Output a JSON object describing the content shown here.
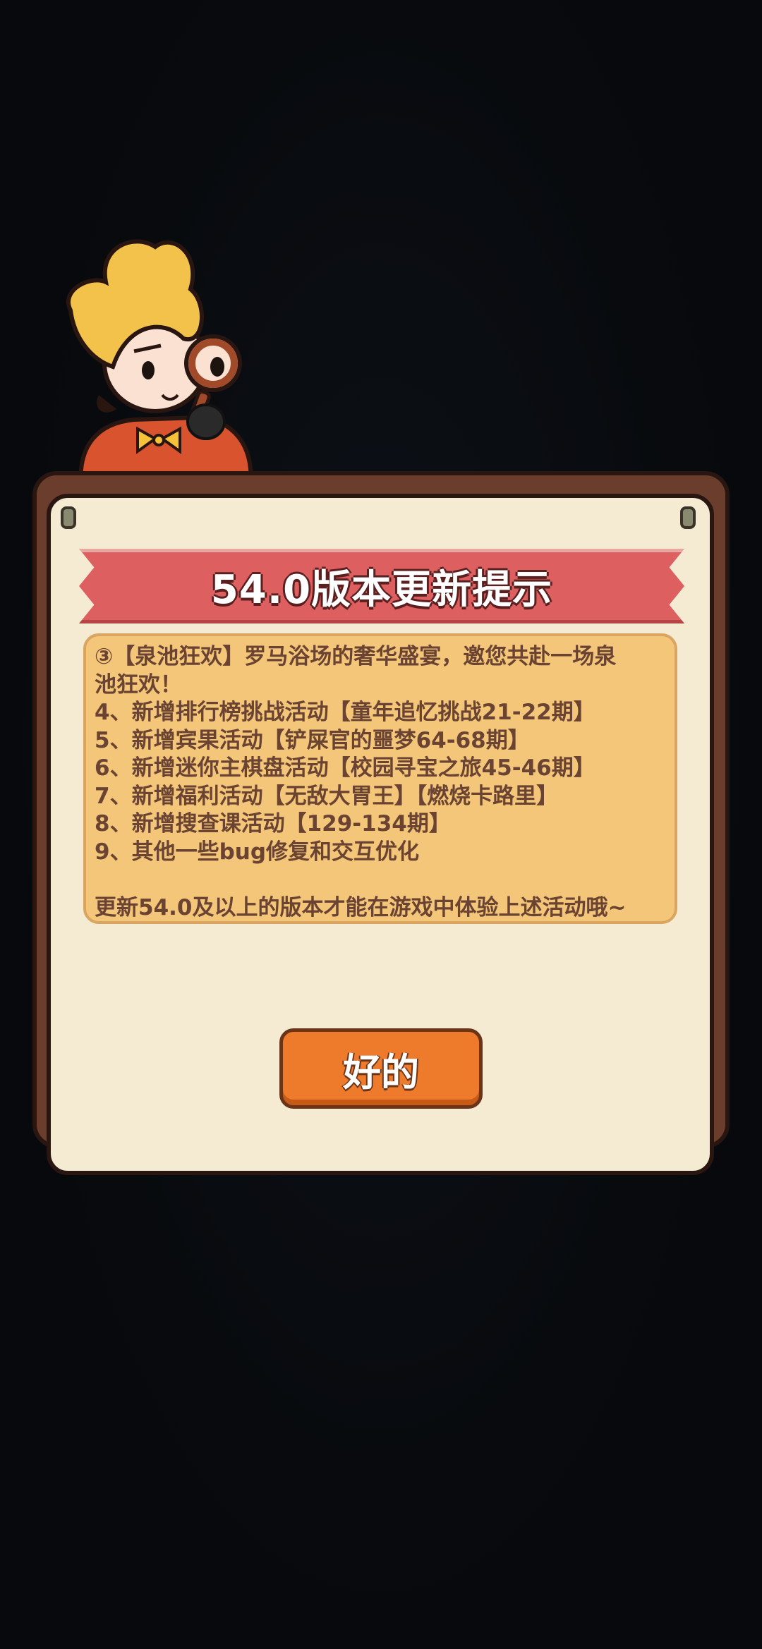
{
  "dialog": {
    "title": "54.0版本更新提示",
    "lines": [
      "③【泉池狂欢】罗马浴场的奢华盛宴，邀您共赴一场泉",
      "池狂欢！",
      "4、新增排行榜挑战活动【童年追忆挑战21-22期】",
      "5、新增宾果活动【铲屎官的噩梦64-68期】",
      "6、新增迷你主棋盘活动【校园寻宝之旅45-46期】",
      "7、新增福利活动【无敌大胃王】【燃烧卡路里】",
      "8、新增搜查课活动【129-134期】",
      "9、其他一些bug修复和交互优化",
      "",
      "更新54.0及以上的版本才能在游戏中体验上述活动哦~"
    ],
    "ok_label": "好的"
  },
  "icons": {
    "mascot": "detective-mascot-icon",
    "pins": "pin-icon"
  },
  "colors": {
    "background": "#080b0f",
    "frame": "#6b3d2c",
    "paper": "#f5ead2",
    "ribbon": "#dd5f5f",
    "content_box": "#f3c679",
    "text": "#6a4332",
    "button": "#ee7a2b"
  }
}
